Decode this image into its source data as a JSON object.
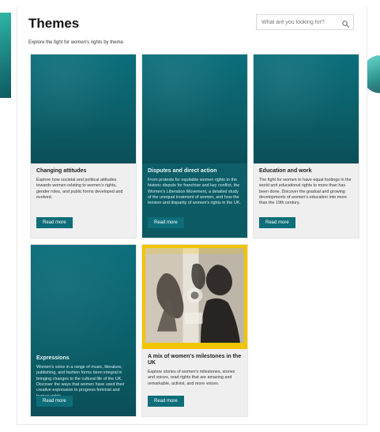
{
  "header": {
    "title": "Themes",
    "subtitle": "Explore the fight for women's rights by theme.",
    "search_placeholder": "What are you looking for?"
  },
  "cards": [
    {
      "title": "Changing attitudes",
      "text": "Explore how societal and political attitudes towards women relating to women's rights, gender roles, and public forms developed and evolved.",
      "button": "Read more"
    },
    {
      "title": "Disputes and direct action",
      "text": "From protests for equitable women rights to the historic dispute for franchise and key conflict, the Women's Liberation Movement, a detailed study of the unequal treatment of women, and how the tension and disparity of women's rights in the UK.",
      "button": "Read more"
    },
    {
      "title": "Education and work",
      "text": "The fight for women to have equal footings in the world and educational rights to more than has been done. Discover the gradual and growing developments of women's education into more than the 19th century.",
      "button": "Read more"
    },
    {
      "title": "Expressions",
      "text": "Women's voice in a range of music, literature, publishing, and fashion forms been integral in bringing changes to the cultural life of the UK. Discover the ways that women have used their creative expression to progress feminist and human rights.",
      "button": "Read more"
    },
    {
      "title": "A mix of women's milestones in the UK",
      "text": "Explore stories of women's milestones, stories and voices, read rights that are amazing and remarkable, activist, and more voices.",
      "button": "Read more"
    }
  ],
  "colors": {
    "teal": "#0d6d79",
    "card_bg": "#efefef",
    "photo_frame": "#f2c400"
  }
}
